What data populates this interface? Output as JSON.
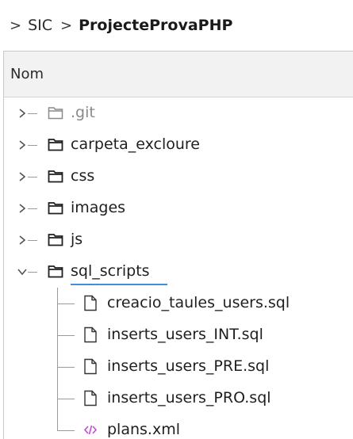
{
  "breadcrumb": {
    "items": [
      "SIC",
      "ProjecteProvaPHP"
    ]
  },
  "header": {
    "column_name": "Nom"
  },
  "tree": {
    "folders": [
      {
        "name": ".git",
        "dimmed": true
      },
      {
        "name": "carpeta_excloure",
        "dimmed": false
      },
      {
        "name": "css",
        "dimmed": false
      },
      {
        "name": "images",
        "dimmed": false
      },
      {
        "name": "js",
        "dimmed": false
      },
      {
        "name": "sql_scripts",
        "dimmed": false,
        "expanded": true
      }
    ],
    "files": [
      {
        "name": "creacio_taules_users.sql",
        "icon": "file-icon"
      },
      {
        "name": "inserts_users_INT.sql",
        "icon": "file-icon"
      },
      {
        "name": "inserts_users_PRE.sql",
        "icon": "file-icon"
      },
      {
        "name": "inserts_users_PRO.sql",
        "icon": "file-icon"
      },
      {
        "name": "plans.xml",
        "icon": "xml-code-icon"
      }
    ]
  },
  "colors": {
    "accent": "#3d8fe0",
    "xml_icon": "#c14fd6"
  }
}
